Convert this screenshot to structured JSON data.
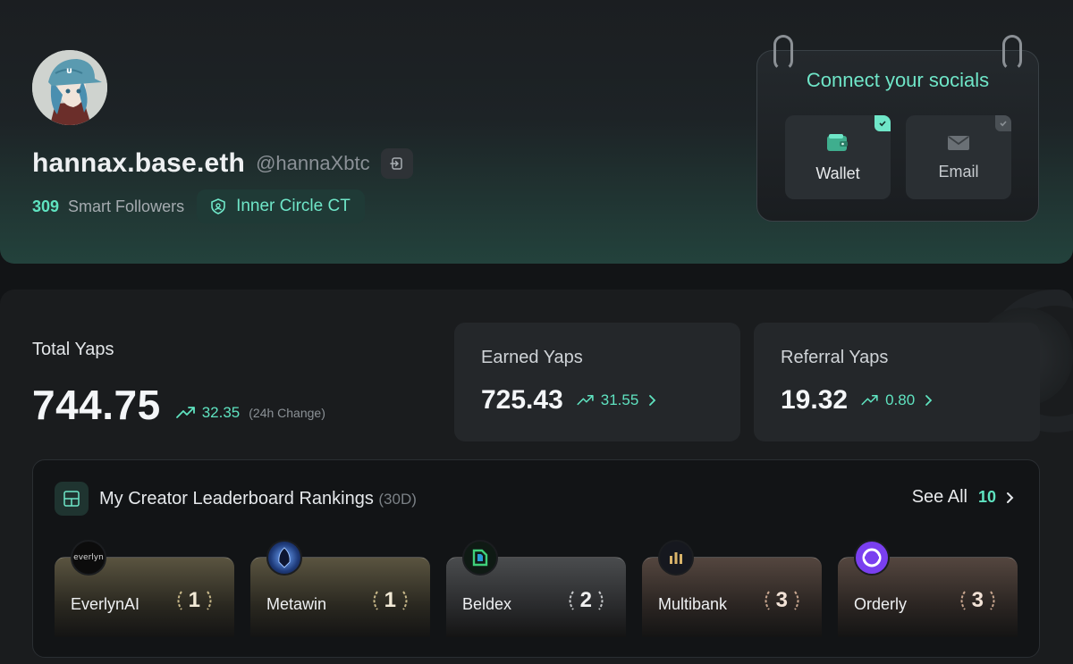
{
  "profile": {
    "display_name": "hannax.base.eth",
    "handle": "@hannaXbtc",
    "followers_count": "309",
    "followers_label": "Smart Followers",
    "badge_label": "Inner Circle CT"
  },
  "socials": {
    "title": "Connect your socials",
    "items": [
      {
        "label": "Wallet",
        "connected": true
      },
      {
        "label": "Email",
        "connected": false
      }
    ]
  },
  "stats": {
    "total": {
      "label": "Total Yaps",
      "value": "744.75",
      "change": "32.35",
      "change_note": "(24h Change)"
    },
    "earned": {
      "label": "Earned Yaps",
      "value": "725.43",
      "change": "31.55"
    },
    "referral": {
      "label": "Referral Yaps",
      "value": "19.32",
      "change": "0.80"
    }
  },
  "leaderboard": {
    "title": "My Creator Leaderboard Rankings",
    "period": "(30D)",
    "see_all_label": "See All",
    "see_all_count": "10",
    "items": [
      {
        "name": "EverlynAI",
        "rank": "1",
        "logo_text": "everlyn"
      },
      {
        "name": "Metawin",
        "rank": "1"
      },
      {
        "name": "Beldex",
        "rank": "2"
      },
      {
        "name": "Multibank",
        "rank": "3"
      },
      {
        "name": "Orderly",
        "rank": "3"
      }
    ]
  },
  "colors": {
    "accent": "#5fe3c0",
    "background": "#121416",
    "card": "#24272a"
  }
}
